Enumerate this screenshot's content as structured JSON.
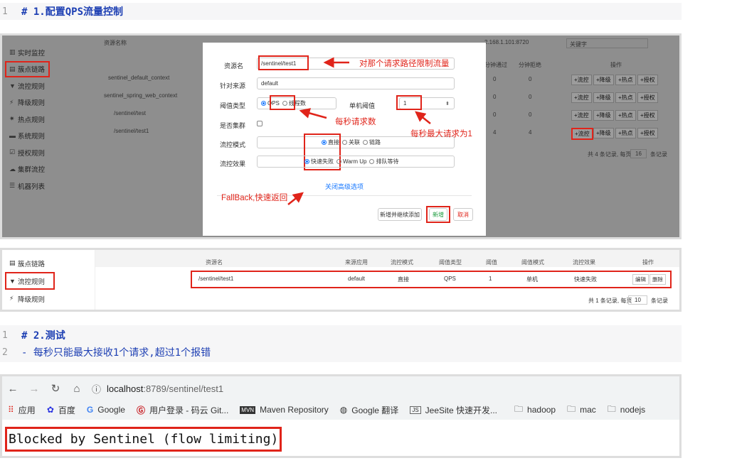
{
  "code1": {
    "line_no": "1",
    "text": "# 1.配置QPS流量控制"
  },
  "screenshot1": {
    "sidebar": [
      "实时监控",
      "簇点链路",
      "流控规则",
      "降级规则",
      "热点规则",
      "系统规则",
      "授权规则",
      "集群流控",
      "机器列表"
    ],
    "bg": {
      "header_col": "资源名称",
      "ip": "2.168.1.101:8720",
      "search_placeholder": "关键字",
      "rows": [
        "sentinel_default_context",
        "sentinel_spring_web_context",
        "/sentinel/test",
        "/sentinel/test1"
      ],
      "col_pass": "分钟通过",
      "col_reject": "分钟拒绝",
      "col_ops": "操作",
      "pass_vals": [
        "0",
        "0",
        "0",
        "4"
      ],
      "reject_vals": [
        "0",
        "0",
        "0",
        "4"
      ],
      "btn_flow": "+流控",
      "btn_degrade": "+降级",
      "btn_hot": "+热点",
      "btn_auth": "+授权",
      "pager": "共 4 条记录, 每页",
      "pager_size": "16",
      "pager_unit": "条记录"
    },
    "modal": {
      "resource_label": "资源名",
      "resource_value": "/sentinel/test1",
      "source_label": "针对来源",
      "source_value": "default",
      "threshold_type_label": "阈值类型",
      "qps": "QPS",
      "threads": "线程数",
      "single_threshold_label": "单机阈值",
      "threshold_value": "1",
      "cluster_label": "是否集群",
      "mode_label": "流控模式",
      "mode_direct": "直接",
      "mode_assoc": "关联",
      "mode_chain": "链路",
      "effect_label": "流控效果",
      "effect_fail": "快速失败",
      "effect_warm": "Warm Up",
      "effect_queue": "排队等待",
      "advanced": "关闭高级选项",
      "btn_add_continue": "新增并继续添加",
      "btn_add": "新增",
      "btn_cancel": "取消"
    },
    "annotations": {
      "a1": "对那个请求路径限制流量",
      "a2": "每秒请求数",
      "a3": "每秒最大请求为1",
      "a4": "FallBack,快速返回"
    }
  },
  "screenshot2": {
    "sidebar": [
      "簇点链路",
      "流控规则",
      "降级规则"
    ],
    "headers": [
      "资源名",
      "来源应用",
      "流控模式",
      "阈值类型",
      "阈值",
      "阈值模式",
      "流控效果",
      "操作"
    ],
    "row": [
      "/sentinel/test1",
      "default",
      "直接",
      "QPS",
      "1",
      "单机",
      "快速失败"
    ],
    "btn_edit": "编辑",
    "btn_delete": "删除",
    "pager": "共 1 条记录, 每页",
    "pager_size": "10",
    "pager_unit": "条记录"
  },
  "code2": [
    {
      "line_no": "1",
      "text": "# 2.测试"
    },
    {
      "line_no": "2",
      "text": "- 每秒只能最大接收1个请求,超过1个报错"
    }
  ],
  "browser": {
    "url_host": "localhost",
    "url_rest": ":8789/sentinel/test1",
    "bookmarks": [
      "应用",
      "百度",
      "Google",
      "用户登录 - 码云 Git...",
      "Maven Repository",
      "Google 翻译",
      "JeeSite 快速开发...",
      "hadoop",
      "mac",
      "nodejs"
    ],
    "body_text": "Blocked by Sentinel (flow limiting)"
  }
}
